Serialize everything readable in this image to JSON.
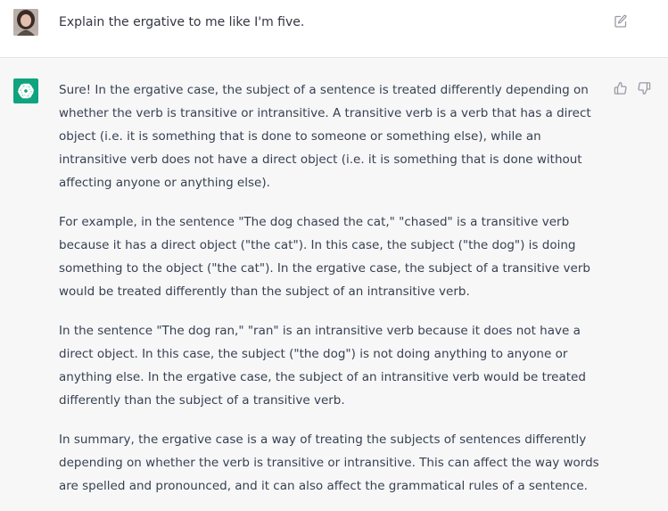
{
  "user_message": {
    "text": "Explain the ergative to me like I'm five."
  },
  "icons": {
    "edit": "edit-icon",
    "thumbs_up": "thumbs-up-icon",
    "thumbs_down": "thumbs-down-icon",
    "assistant_logo": "openai-logo-icon"
  },
  "colors": {
    "assistant_bg": "#f7f7f8",
    "logo_bg": "#10a37f",
    "text": "#374151"
  },
  "assistant_message": {
    "paragraphs": [
      "Sure! In the ergative case, the subject of a sentence is treated differently depending on whether the verb is transitive or intransitive. A transitive verb is a verb that has a direct object (i.e. it is something that is done to someone or something else), while an intransitive verb does not have a direct object (i.e. it is something that is done without affecting anyone or anything else).",
      "For example, in the sentence \"The dog chased the cat,\" \"chased\" is a transitive verb because it has a direct object (\"the cat\"). In this case, the subject (\"the dog\") is doing something to the object (\"the cat\"). In the ergative case, the subject of a transitive verb would be treated differently than the subject of an intransitive verb.",
      "In the sentence \"The dog ran,\" \"ran\" is an intransitive verb because it does not have a direct object. In this case, the subject (\"the dog\") is not doing anything to anyone or anything else. In the ergative case, the subject of an intransitive verb would be treated differently than the subject of a transitive verb.",
      "In summary, the ergative case is a way of treating the subjects of sentences differently depending on whether the verb is transitive or intransitive. This can affect the way words are spelled and pronounced, and it can also affect the grammatical rules of a sentence."
    ]
  }
}
